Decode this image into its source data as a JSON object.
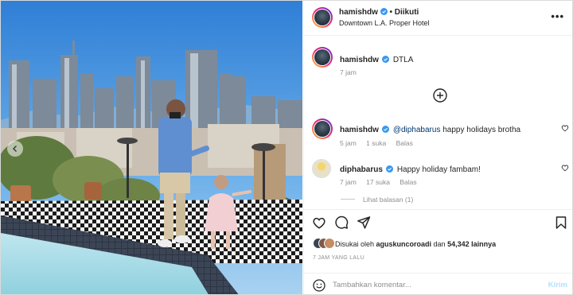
{
  "post": {
    "author": "hamishdw",
    "follow_status": "• Diikuti",
    "location": "Downtown L.A. Proper Hotel",
    "more_label": "•••"
  },
  "caption": {
    "username": "hamishdw",
    "text": "DTLA",
    "time": "7 jam"
  },
  "comments": [
    {
      "username": "hamishdw",
      "mention": "@diphabarus",
      "text": " happy holidays brotha",
      "time": "5 jam",
      "likes": "1 suka",
      "reply": "Balas"
    },
    {
      "username": "diphabarus",
      "text": "Happy holiday fambam!",
      "time": "7 jam",
      "likes": "17 suka",
      "reply": "Balas"
    }
  ],
  "view_replies": "Lihat balasan (1)",
  "liked_by": {
    "prefix": "Disukai oleh ",
    "user": "agusku­ncoroadi",
    "user_display": "aguskuncoroadi",
    "mid": " dan ",
    "count": "54,342",
    "suffix": " lainnya"
  },
  "posted_ago": "7 JAM YANG LALU",
  "comment_input": {
    "placeholder": "Tambahkan komentar...",
    "send": "Kirim"
  },
  "icons": {
    "verified": "verified-badge-icon",
    "like": "heart-icon",
    "comment": "comment-bubble-icon",
    "share": "paper-plane-icon",
    "save": "bookmark-icon",
    "emoji": "smiley-icon",
    "add": "plus-circle-icon",
    "prev": "chevron-left-icon"
  },
  "colors": {
    "verified": "#3897f0",
    "link": "#00376b",
    "meta": "#8e8e8e",
    "send_disabled": "#b2dffc"
  }
}
